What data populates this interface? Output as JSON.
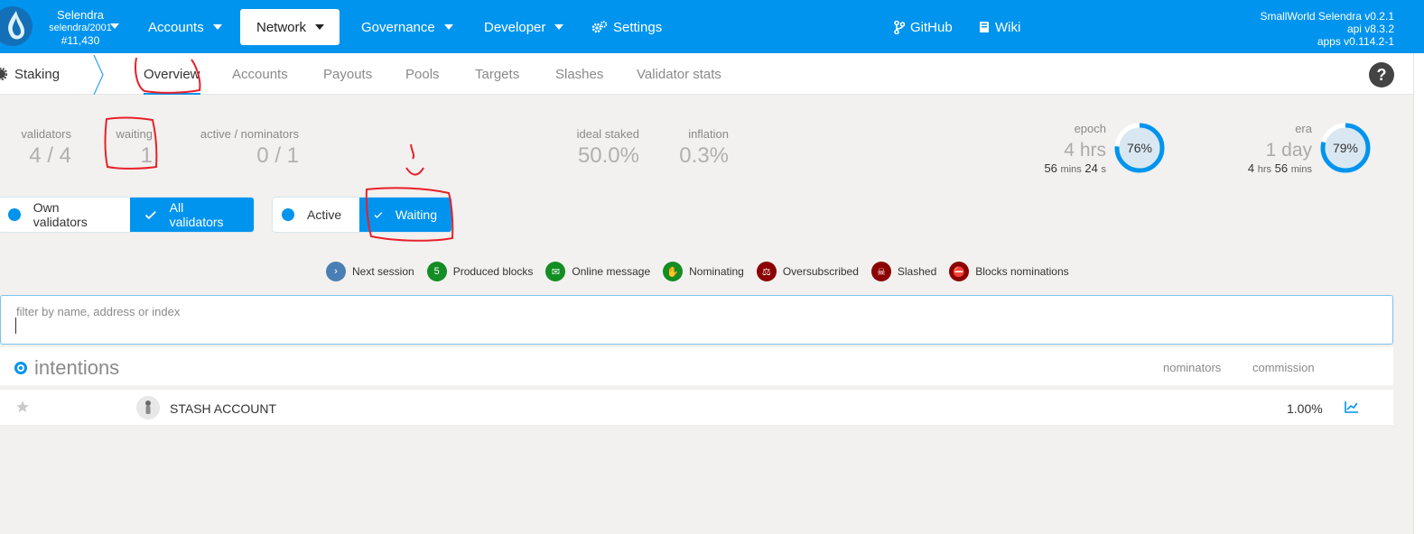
{
  "chain": {
    "name": "Selendra",
    "sub": "selendra/2001",
    "block": "#11,430"
  },
  "menu": {
    "accounts": "Accounts",
    "network": "Network",
    "governance": "Governance",
    "developer": "Developer",
    "settings": "Settings",
    "github": "GitHub",
    "wiki": "Wiki"
  },
  "versions": {
    "node": "SmallWorld Selendra v0.2.1",
    "api": "api v8.3.2",
    "apps": "apps v0.114.2-1"
  },
  "subnav": {
    "section": "Staking",
    "tabs": [
      "Overview",
      "Accounts",
      "Payouts",
      "Pools",
      "Targets",
      "Slashes",
      "Validator stats"
    ],
    "help": "?"
  },
  "summary": {
    "validators": {
      "label": "validators",
      "value": "4 / 4"
    },
    "waiting": {
      "label": "waiting",
      "value": "1"
    },
    "active_nominators": {
      "label": "active / nominators",
      "value": "0 / 1"
    },
    "ideal_staked": {
      "label": "ideal staked",
      "value": "50.0%"
    },
    "inflation": {
      "label": "inflation",
      "value": "0.3%"
    },
    "epoch": {
      "label": "epoch",
      "big_num": "4",
      "big_unit": "hrs",
      "small_a": "56",
      "small_a_unit": "mins",
      "small_b": "24",
      "small_b_unit": "s",
      "percent": 76,
      "percent_text": "76%"
    },
    "era": {
      "label": "era",
      "big_num": "1",
      "big_unit": "day",
      "small_a": "4",
      "small_a_unit": "hrs",
      "small_b": "56",
      "small_b_unit": "mins",
      "percent": 79,
      "percent_text": "79%"
    }
  },
  "toggles": {
    "own_validators": "Own validators",
    "all_validators": "All validators",
    "active": "Active",
    "waiting": "Waiting"
  },
  "legend": [
    {
      "label": "Next session",
      "icon": "chevron-right-icon",
      "color": "#4a7fb5",
      "glyph": "›"
    },
    {
      "label": "Produced blocks",
      "icon": "count-badge-icon",
      "color": "#138d24",
      "glyph": "5"
    },
    {
      "label": "Online message",
      "icon": "envelope-icon",
      "color": "#138d24",
      "glyph": "✉"
    },
    {
      "label": "Nominating",
      "icon": "hand-icon",
      "color": "#138d24",
      "glyph": "✋"
    },
    {
      "label": "Oversubscribed",
      "icon": "balance-scale-icon",
      "color": "#8b0000",
      "glyph": "⚖"
    },
    {
      "label": "Slashed",
      "icon": "skull-crossbones-icon",
      "color": "#8b0000",
      "glyph": "☠"
    },
    {
      "label": "Blocks nominations",
      "icon": "user-slash-icon",
      "color": "#8b0000",
      "glyph": "⛔"
    }
  ],
  "filter": {
    "label": "filter by name, address or index",
    "value": ""
  },
  "table": {
    "title": "intentions",
    "col_nominators": "nominators",
    "col_commission": "commission",
    "rows": [
      {
        "account": "STASH ACCOUNT",
        "commission": "1.00%"
      }
    ]
  },
  "colors": {
    "accent": "#0094ee",
    "annotation": "#e8202a"
  }
}
